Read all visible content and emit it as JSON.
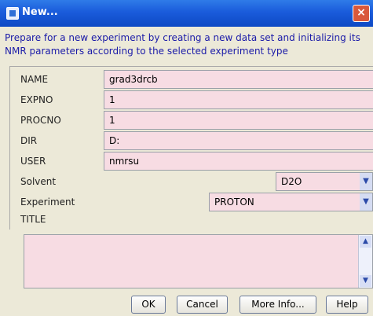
{
  "window": {
    "title": "New...",
    "close_label": "×"
  },
  "description": "Prepare for a new experiment by creating a new data set and initializing its NMR parameters according to the selected experiment type",
  "fields": [
    {
      "label": "NAME",
      "value": "grad3drcb"
    },
    {
      "label": "EXPNO",
      "value": "1"
    },
    {
      "label": "PROCNO",
      "value": "1"
    },
    {
      "label": "DIR",
      "value": "D:"
    },
    {
      "label": "USER",
      "value": "nmrsu"
    }
  ],
  "solvent": {
    "label": "Solvent",
    "value": "D2O"
  },
  "experiment": {
    "label": "Experiment",
    "value": "PROTON"
  },
  "title_label": "TITLE",
  "buttons": {
    "ok": "OK",
    "cancel": "Cancel",
    "more_info": "More Info...",
    "help": "Help"
  },
  "colors": {
    "field_bg": "#f7dce3",
    "description_text": "#1a1aa8",
    "titlebar": "#1a5bdb"
  },
  "icons": {
    "window": "window-app-icon",
    "close": "close-icon",
    "dropdown": "chevron-down-icon",
    "scroll_up": "scroll-up-icon",
    "scroll_down": "scroll-down-icon"
  }
}
